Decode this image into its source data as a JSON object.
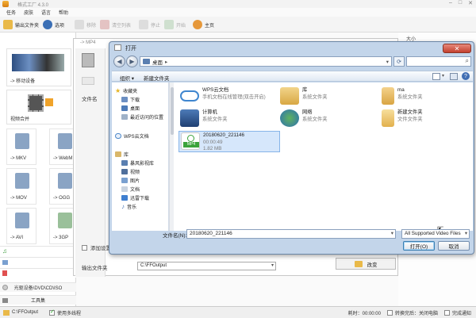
{
  "app": {
    "title": "格式工厂 4.3.0",
    "menu": [
      "任务",
      "皮肤",
      "语言",
      "帮助"
    ],
    "toolbar": {
      "output_folder": "输出文件夹",
      "options": "选项",
      "remove": "移除",
      "clear": "清空列表",
      "stop": "停止",
      "start": "开始",
      "website": "主页"
    },
    "sidebar": {
      "mobile": "-> 移动设备",
      "merge": "视频合并",
      "formats": [
        "-> MKV",
        "-> WebM",
        "-> MOV",
        "-> OGG",
        "-> AVI",
        "-> 3GP"
      ],
      "rows": [
        "光驱设备\\DVD\\CD\\ISO",
        "工具集"
      ]
    },
    "subwindow": {
      "title": "-> MP4",
      "filename_header": "文件名",
      "add_settings": "添加设置",
      "output_folder_label": "输出文件夹",
      "output_folder_value": "C:\\FFOutput",
      "change_button": "改变"
    },
    "right_header": "大小",
    "statusbar": {
      "path": "C:\\FFOutput",
      "multithread": "使用多线程",
      "elapsed_label": "耗时：00:00:00",
      "shutdown": "转换完后：关闭电脑",
      "notify": "完成通知"
    }
  },
  "dialog": {
    "title": "打开",
    "close_symbol": "✕",
    "address": "桌面",
    "address_arrow": "▸",
    "organize": "组织 ▾",
    "new_folder": "新建文件夹",
    "help_symbol": "?",
    "nav": {
      "favorites": "收藏夹",
      "downloads": "下载",
      "desktop": "桌面",
      "recent": "最近访问的位置",
      "wps_cloud": "WPS云文档",
      "libraries": "库",
      "baofeng": "暴风影视库",
      "videos": "视频",
      "pictures": "图片",
      "documents": "文档",
      "xunlei": "迅雷下载",
      "music": "音乐"
    },
    "items": [
      {
        "name": "WPS云文档",
        "desc": "手机文档在线管理(双击开启)"
      },
      {
        "name": "库",
        "desc": "系统文件夹"
      },
      {
        "name": "ma",
        "desc": "系统文件夹"
      },
      {
        "name": "计算机",
        "desc": "系统文件夹"
      },
      {
        "name": "网络",
        "desc": "系统文件夹"
      },
      {
        "name": "新建文件夹",
        "desc": "文件文件夹"
      },
      {
        "name": "20180620_221146",
        "duration": "00:00:49",
        "size": "1.82 MB",
        "badge": "MP4"
      }
    ],
    "filename_label": "文件名(N):",
    "filename_value": "20180620_221146",
    "filetype_value": "All Supported Video Files",
    "open_button": "打开(O)",
    "cancel_button": "取消"
  },
  "colors": {
    "dialog_frame": "#c3d5ea",
    "selection": "#d6e7fb",
    "mp4_badge": "#3ba33b",
    "close_button": "#c4402e"
  }
}
